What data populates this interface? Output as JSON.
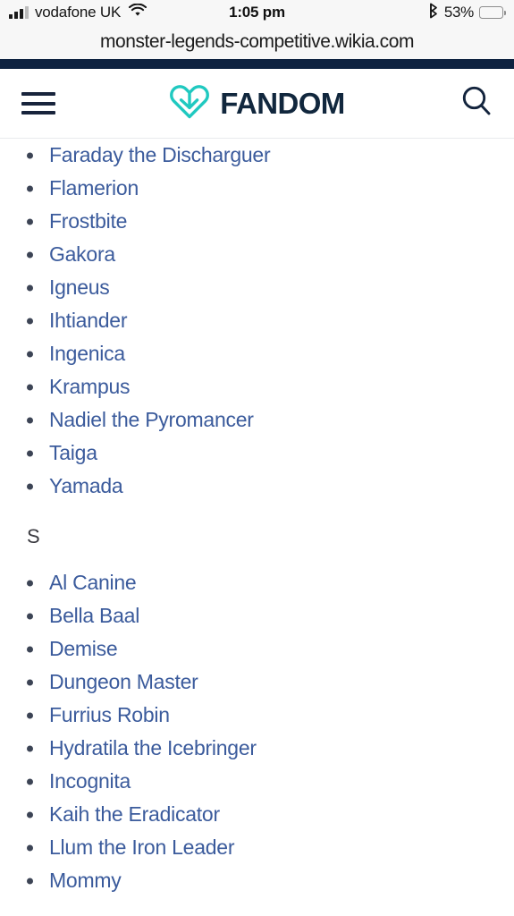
{
  "status_bar": {
    "signal_icon": "cellular-signal-icon",
    "signal_bars_total": 4,
    "signal_bars_filled": 3,
    "carrier": "vodafone UK",
    "wifi_icon": "wifi-icon",
    "time": "1:05 pm",
    "bluetooth_icon": "bluetooth-icon",
    "battery_percent": "53%",
    "battery_level": 53,
    "colors": {
      "background": "#f7f7f7",
      "text": "#141414",
      "battery_fill": "#0d0d0d",
      "battery_outline": "#8d8d8d",
      "signal_inactive": "#bcbcbc"
    }
  },
  "browser": {
    "url": "monster-legends-competitive.wikia.com"
  },
  "site_header": {
    "menu_icon": "hamburger-menu-icon",
    "logo_icon": "fandom-heart-logo-icon",
    "brand_name": "FANDOM",
    "search_icon": "search-icon",
    "colors": {
      "accent_stripe": "#0e2240",
      "logo_teal": "#20c9c0",
      "brand_text": "#11273d",
      "icon": "#18243c",
      "border": "#e8eaed"
    }
  },
  "article": {
    "link_color": "#3b5b9c",
    "bullet_color": "#3c4455",
    "heading_color": "#3a3a40",
    "blocks": [
      {
        "type": "list",
        "items": [
          "Faraday the Discharguer",
          "Flamerion",
          "Frostbite",
          "Gakora",
          "Igneus",
          "Ihtiander",
          "Ingenica",
          "Krampus",
          "Nadiel the Pyromancer",
          "Taiga",
          "Yamada"
        ]
      },
      {
        "type": "heading",
        "text": "S"
      },
      {
        "type": "list",
        "items": [
          "Al Canine",
          "Bella Baal",
          "Demise",
          "Dungeon Master",
          "Furrius Robin",
          "Hydratila the Icebringer",
          "Incognita",
          "Kaih the Eradicator",
          "Llum the Iron Leader",
          "Mommy"
        ]
      }
    ]
  }
}
